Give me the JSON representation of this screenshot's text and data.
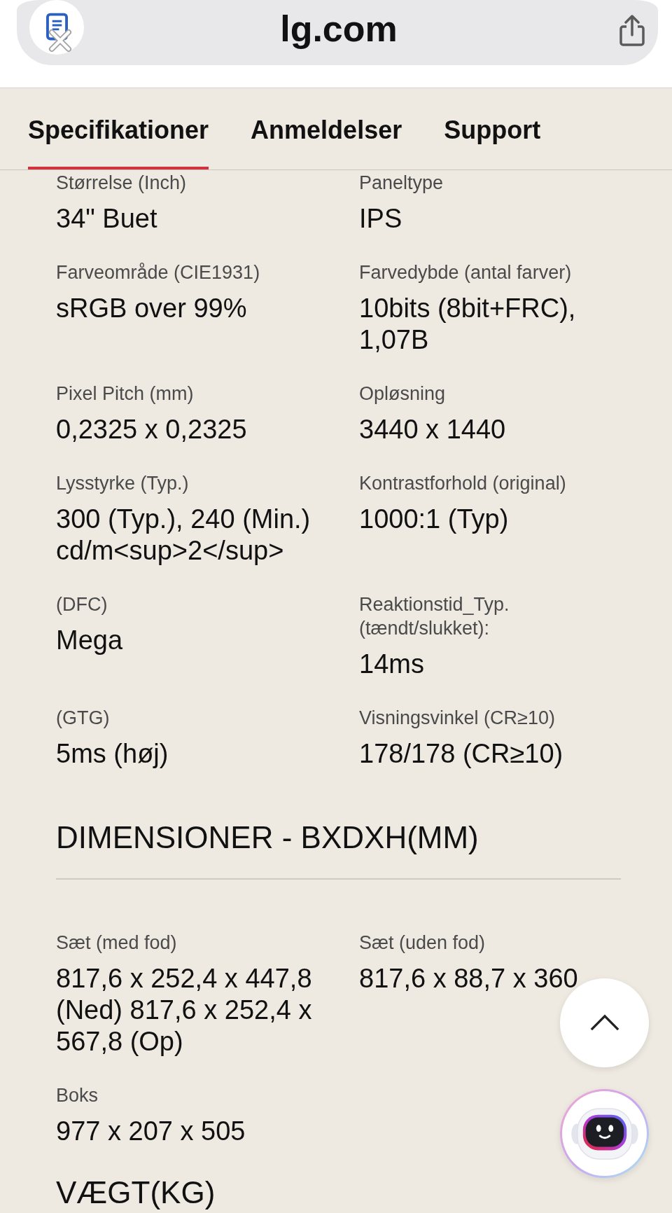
{
  "browser": {
    "address": "lg.com"
  },
  "tabs": [
    {
      "label": "Specifikationer",
      "selected": true
    },
    {
      "label": "Anmeldelser",
      "selected": false
    },
    {
      "label": "Support",
      "selected": false
    }
  ],
  "sections": [
    {
      "specs": [
        {
          "label": "Størrelse (Inch)",
          "value": "34\" Buet"
        },
        {
          "label": "Paneltype",
          "value": "IPS"
        },
        {
          "label": "Farveområde (CIE1931)",
          "value": "sRGB over 99%"
        },
        {
          "label": "Farvedybde (antal farver)",
          "value": "10bits (8bit+FRC), 1,07B"
        },
        {
          "label": "Pixel Pitch (mm)",
          "value": "0,2325 x 0,2325"
        },
        {
          "label": "Opløsning",
          "value": "3440 x 1440"
        },
        {
          "label": "Lysstyrke (Typ.)",
          "value": "300 (Typ.), 240 (Min.) cd/m<sup>2</sup>"
        },
        {
          "label": "Kontrastforhold (original)",
          "value": "1000:1 (Typ)"
        },
        {
          "label": "(DFC)",
          "value": "Mega"
        },
        {
          "label": "Reaktionstid_Typ. (tændt/slukket):",
          "value": "14ms"
        },
        {
          "label": "(GTG)",
          "value": "5ms (høj)"
        },
        {
          "label": "Visningsvinkel (CR≥10)",
          "value": "178/178 (CR≥10)"
        }
      ]
    },
    {
      "heading": "DIMENSIONER - BXDXH(MM)",
      "specs": [
        {
          "label": "Sæt (med fod)",
          "value": "817,6 x 252,4 x 447,8 (Ned) 817,6 x 252,4 x 567,8 (Op)"
        },
        {
          "label": "Sæt (uden fod)",
          "value": "817,6 x 88,7 x 360"
        },
        {
          "label": "Boks",
          "value": "977 x 207 x 505"
        }
      ]
    },
    {
      "heading": "VÆGT(KG)"
    }
  ]
}
